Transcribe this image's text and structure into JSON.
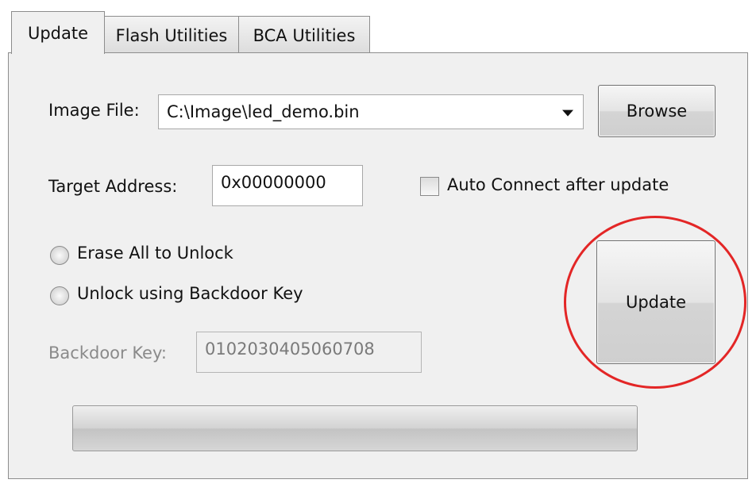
{
  "tabs": [
    {
      "label": "Update",
      "active": true
    },
    {
      "label": "Flash Utilities",
      "active": false
    },
    {
      "label": "BCA Utilities",
      "active": false
    }
  ],
  "image_file": {
    "label": "Image File:",
    "value": "C:\\Image\\led_demo.bin",
    "browse_label": "Browse"
  },
  "target_address": {
    "label": "Target Address:",
    "value": "0x00000000"
  },
  "auto_connect": {
    "label": "Auto Connect after update",
    "checked": false
  },
  "unlock_options": [
    {
      "label": "Erase All to Unlock",
      "selected": false
    },
    {
      "label": "Unlock using Backdoor Key",
      "selected": false
    }
  ],
  "backdoor_key": {
    "label": "Backdoor Key:",
    "value": "0102030405060708",
    "enabled": false
  },
  "update_button": {
    "label": "Update"
  },
  "progress": {
    "value": 0
  },
  "colors": {
    "highlight": "#e32626",
    "panel_bg": "#f0f0f0"
  }
}
